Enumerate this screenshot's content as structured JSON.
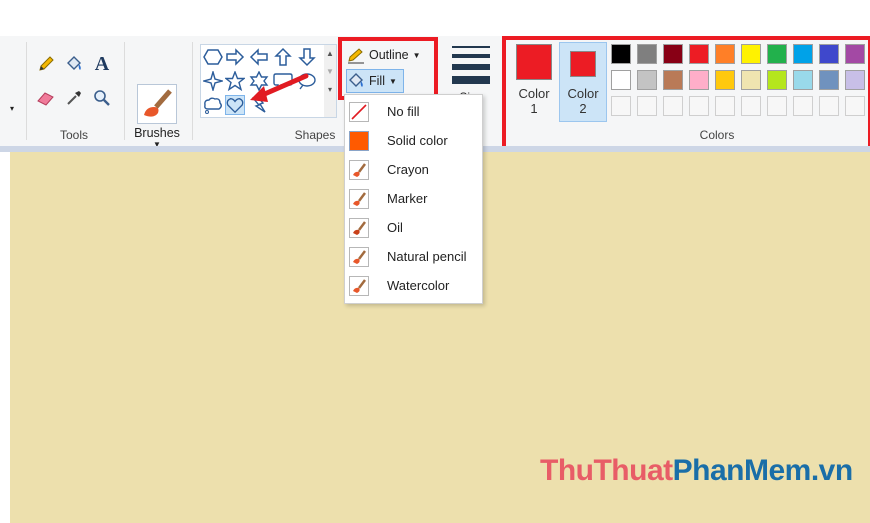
{
  "ribbon": {
    "tools_group_label": "Tools",
    "brushes_label": "Brushes",
    "shapes_group_label": "Shapes",
    "outline_label": "Outline",
    "fill_label": "Fill",
    "size_label": "Size",
    "color1_label": "Color",
    "color1_num": "1",
    "color2_label": "Color",
    "color2_num": "2",
    "colors_group_label": "Colors"
  },
  "fill_menu": {
    "items": [
      {
        "label": "No fill",
        "icon": "no-fill-icon"
      },
      {
        "label": "Solid color",
        "icon": "solid-color-icon"
      },
      {
        "label": "Crayon",
        "icon": "crayon-icon"
      },
      {
        "label": "Marker",
        "icon": "marker-icon"
      },
      {
        "label": "Oil",
        "icon": "oil-icon"
      },
      {
        "label": "Natural pencil",
        "icon": "natural-pencil-icon"
      },
      {
        "label": "Watercolor",
        "icon": "watercolor-icon"
      }
    ]
  },
  "palette": {
    "color1": "#ec1c24",
    "color2": "#ec1c24",
    "row1": [
      "#000000",
      "#7f7f7f",
      "#880015",
      "#ed1c24",
      "#ff7f27",
      "#fff200",
      "#22b14c",
      "#00a2e8",
      "#3f48cc",
      "#a349a4"
    ],
    "row2": [
      "#ffffff",
      "#c3c3c3",
      "#b97a57",
      "#ffaec9",
      "#ffc90e",
      "#efe4b0",
      "#b5e61d",
      "#99d9ea",
      "#7092be",
      "#c8bfe7"
    ]
  },
  "canvas": {
    "background": "#ede0ad"
  },
  "watermark": {
    "part1": "ThuThuat",
    "part2": "PhanMem",
    "part3": ".vn"
  }
}
